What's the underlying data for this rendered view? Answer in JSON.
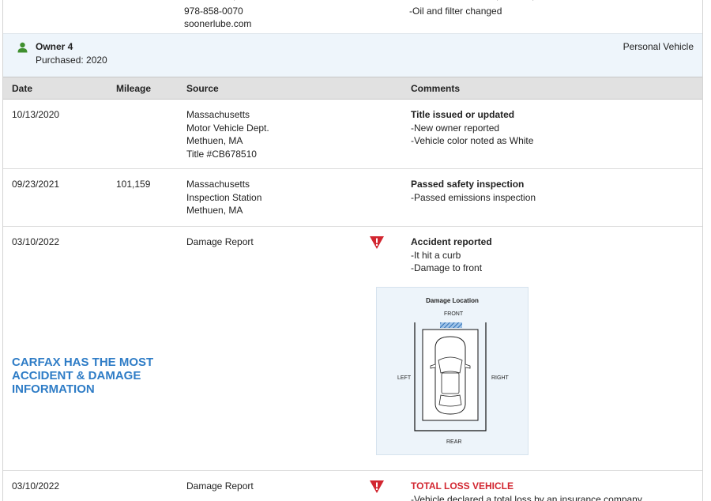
{
  "previous_record": {
    "source_lines": [
      "978-858-0070",
      "soonerlube.com"
    ],
    "comment_lines": [
      "-Oil and filter changed"
    ]
  },
  "owner": {
    "title": "Owner 4",
    "purchased": "Purchased: 2020",
    "vehicle_type": "Personal Vehicle",
    "icon": "person-icon"
  },
  "table": {
    "headers": {
      "date": "Date",
      "mileage": "Mileage",
      "source": "Source",
      "comments": "Comments"
    },
    "rows": [
      {
        "date": "10/13/2020",
        "mileage": "",
        "source_lines": [
          "Massachusetts",
          "Motor Vehicle Dept.",
          "Methuen, MA",
          "Title #CB678510"
        ],
        "comment_title": "Title issued or updated",
        "comment_lines": [
          "-New owner reported",
          "-Vehicle color noted as White"
        ],
        "alert": false
      },
      {
        "date": "09/23/2021",
        "mileage": "101,159",
        "source_lines": [
          "Massachusetts",
          "Inspection Station",
          "Methuen, MA"
        ],
        "comment_title": "Passed safety inspection",
        "comment_lines": [
          "-Passed emissions inspection"
        ],
        "alert": false
      },
      {
        "date": "03/10/2022",
        "mileage": "",
        "source_lines": [
          "Damage Report"
        ],
        "comment_title": "Accident reported",
        "comment_lines": [
          "-It hit a curb",
          "-Damage to front"
        ],
        "alert": true
      },
      {
        "date": "03/10/2022",
        "mileage": "",
        "source_lines": [
          "Damage Report"
        ],
        "comment_title": "TOTAL LOSS VEHICLE",
        "comment_lines": [
          "-Vehicle declared a total loss by an insurance company"
        ],
        "alert": true
      }
    ]
  },
  "promo_text": "CARFAX HAS THE MOST ACCIDENT & DAMAGE INFORMATION",
  "damage_diagram": {
    "title": "Damage Location",
    "front": "FRONT",
    "rear": "REAR",
    "left": "LEFT",
    "right": "RIGHT",
    "damaged_area": "front"
  },
  "colors": {
    "accent_blue": "#2e7cc6",
    "alert_red": "#d22630",
    "owner_icon": "#3f8f2e",
    "header_bg": "#e1e1e1",
    "owner_bg": "#eef5fb"
  }
}
